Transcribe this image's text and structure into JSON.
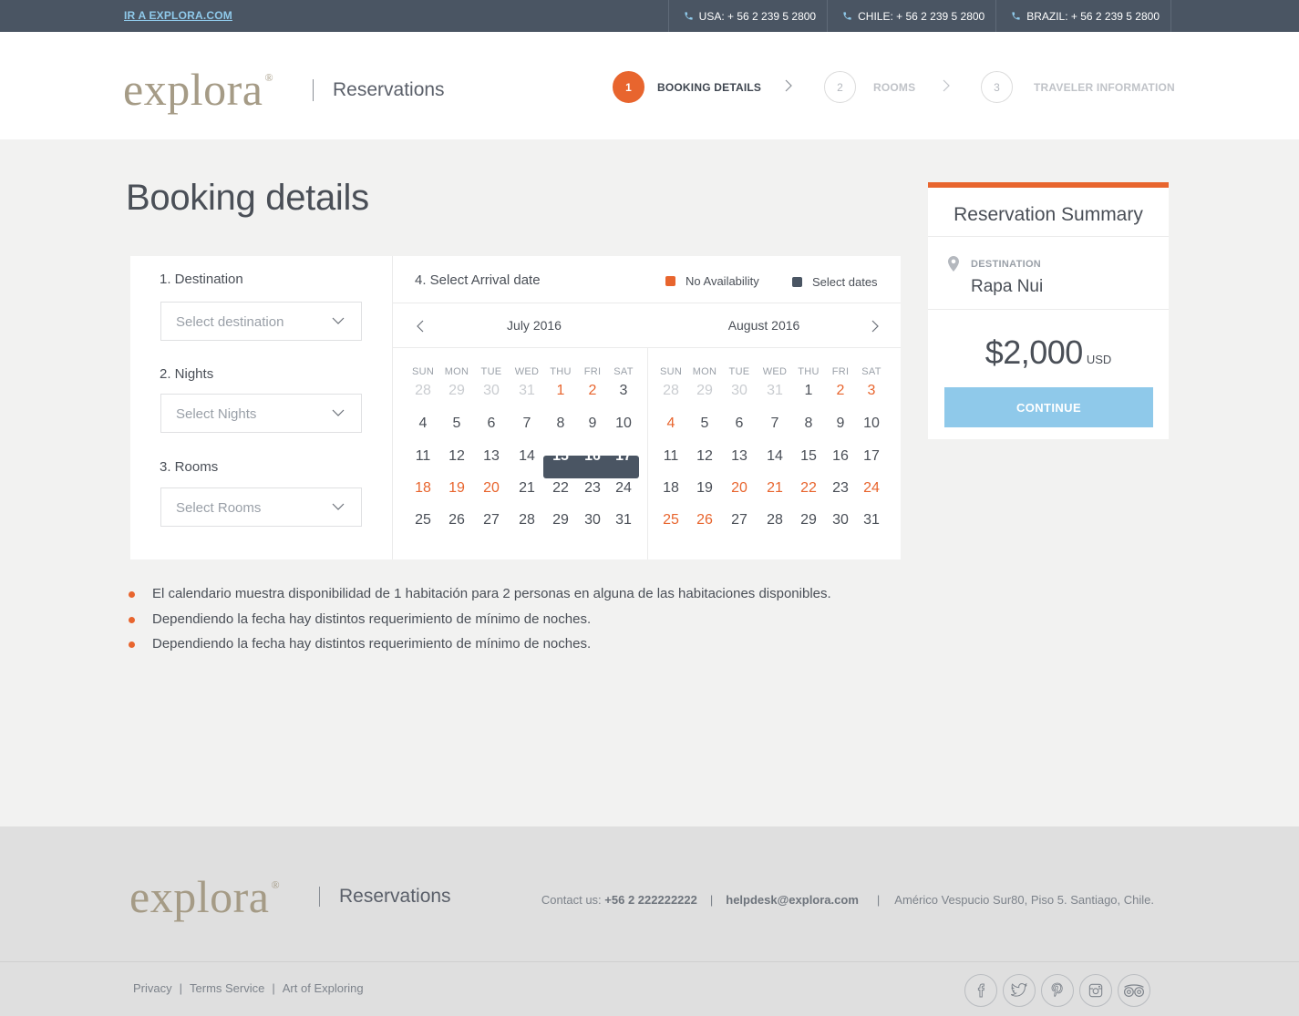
{
  "topbar": {
    "home_link": "IR A EXPLORA.COM",
    "phones": [
      {
        "label": "USA: + 56 2 239 5 2800"
      },
      {
        "label": "CHILE: + 56 2 239 5 2800"
      },
      {
        "label": "BRAZIL: + 56 2 239 5 2800"
      }
    ]
  },
  "header": {
    "logo": "explora",
    "logo_mark": "®",
    "app_name": "Reservations",
    "steps": [
      {
        "number": "1",
        "label": "BOOKING DETAILS",
        "active": true
      },
      {
        "number": "2",
        "label": "ROOMS",
        "active": false
      },
      {
        "number": "3",
        "label": "TRAVELER INFORMATION",
        "active": false
      }
    ]
  },
  "page_title": "Booking details",
  "form": {
    "destination": {
      "label": "1. Destination",
      "placeholder": "Select destination"
    },
    "nights": {
      "label": "2. Nights",
      "placeholder": "Select Nights"
    },
    "rooms": {
      "label": "3. Rooms",
      "placeholder": "Select Rooms"
    }
  },
  "calendar": {
    "title": "4. Select Arrival date",
    "legend": {
      "no_availability": "No Availability",
      "select_dates": "Select dates"
    },
    "weekdays": [
      "SUN",
      "MON",
      "TUE",
      "WED",
      "THU",
      "FRI",
      "SAT"
    ],
    "months": [
      {
        "name": "July 2016",
        "weeks": [
          [
            {
              "d": "28",
              "s": "muted"
            },
            {
              "d": "29",
              "s": "muted"
            },
            {
              "d": "30",
              "s": "muted"
            },
            {
              "d": "31",
              "s": "muted"
            },
            {
              "d": "1",
              "s": "unavail"
            },
            {
              "d": "2",
              "s": "unavail"
            },
            {
              "d": "3",
              "s": ""
            }
          ],
          [
            {
              "d": "4",
              "s": ""
            },
            {
              "d": "5",
              "s": ""
            },
            {
              "d": "6",
              "s": ""
            },
            {
              "d": "7",
              "s": ""
            },
            {
              "d": "8",
              "s": ""
            },
            {
              "d": "9",
              "s": ""
            },
            {
              "d": "10",
              "s": ""
            }
          ],
          [
            {
              "d": "11",
              "s": ""
            },
            {
              "d": "12",
              "s": ""
            },
            {
              "d": "13",
              "s": ""
            },
            {
              "d": "14",
              "s": ""
            },
            {
              "d": "15",
              "s": "sel"
            },
            {
              "d": "16",
              "s": "sel"
            },
            {
              "d": "17",
              "s": "sel"
            }
          ],
          [
            {
              "d": "18",
              "s": "unavail"
            },
            {
              "d": "19",
              "s": "unavail"
            },
            {
              "d": "20",
              "s": "unavail"
            },
            {
              "d": "21",
              "s": ""
            },
            {
              "d": "22",
              "s": ""
            },
            {
              "d": "23",
              "s": ""
            },
            {
              "d": "24",
              "s": ""
            }
          ],
          [
            {
              "d": "25",
              "s": ""
            },
            {
              "d": "26",
              "s": ""
            },
            {
              "d": "27",
              "s": ""
            },
            {
              "d": "28",
              "s": ""
            },
            {
              "d": "29",
              "s": ""
            },
            {
              "d": "30",
              "s": ""
            },
            {
              "d": "31",
              "s": ""
            }
          ]
        ]
      },
      {
        "name": "August 2016",
        "weeks": [
          [
            {
              "d": "28",
              "s": "muted"
            },
            {
              "d": "29",
              "s": "muted"
            },
            {
              "d": "30",
              "s": "muted"
            },
            {
              "d": "31",
              "s": "muted"
            },
            {
              "d": "1",
              "s": ""
            },
            {
              "d": "2",
              "s": "unavail"
            },
            {
              "d": "3",
              "s": "unavail"
            }
          ],
          [
            {
              "d": "4",
              "s": "unavail"
            },
            {
              "d": "5",
              "s": ""
            },
            {
              "d": "6",
              "s": ""
            },
            {
              "d": "7",
              "s": ""
            },
            {
              "d": "8",
              "s": ""
            },
            {
              "d": "9",
              "s": ""
            },
            {
              "d": "10",
              "s": ""
            }
          ],
          [
            {
              "d": "11",
              "s": ""
            },
            {
              "d": "12",
              "s": ""
            },
            {
              "d": "13",
              "s": ""
            },
            {
              "d": "14",
              "s": ""
            },
            {
              "d": "15",
              "s": ""
            },
            {
              "d": "16",
              "s": ""
            },
            {
              "d": "17",
              "s": ""
            }
          ],
          [
            {
              "d": "18",
              "s": ""
            },
            {
              "d": "19",
              "s": ""
            },
            {
              "d": "20",
              "s": "unavail"
            },
            {
              "d": "21",
              "s": "unavail"
            },
            {
              "d": "22",
              "s": "unavail"
            },
            {
              "d": "23",
              "s": ""
            },
            {
              "d": "24",
              "s": "unavail"
            }
          ],
          [
            {
              "d": "25",
              "s": "unavail"
            },
            {
              "d": "26",
              "s": "unavail"
            },
            {
              "d": "27",
              "s": ""
            },
            {
              "d": "28",
              "s": ""
            },
            {
              "d": "29",
              "s": ""
            },
            {
              "d": "30",
              "s": ""
            },
            {
              "d": "31",
              "s": ""
            }
          ]
        ]
      }
    ]
  },
  "notes": [
    "El calendario muestra disponibilidad de 1 habitación para 2 personas en alguna de las habitaciones disponibles.",
    "Dependiendo la fecha hay distintos requerimiento de mínimo de noches.",
    "Dependiendo la fecha hay distintos requerimiento de mínimo de noches."
  ],
  "summary": {
    "title": "Reservation Summary",
    "destination_label": "DESTINATION",
    "destination_value": "Rapa Nui",
    "price": "$2,000",
    "currency": "USD",
    "continue_label": "CONTINUE"
  },
  "footer": {
    "logo": "explora",
    "logo_mark": "®",
    "app_name": "Reservations",
    "contact_prefix": "Contact us:",
    "phone": "+56 2 222222222",
    "email": "helpdesk@explora.com",
    "address": "Américo Vespucio Sur80, Piso 5. Santiago, Chile.",
    "links": [
      "Privacy",
      "Terms Service",
      "Art of Exploring"
    ],
    "social_icons": [
      "facebook-icon",
      "twitter-icon",
      "pinterest-icon",
      "instagram-icon",
      "tripadvisor-icon"
    ]
  },
  "colors": {
    "accent": "#e8652e",
    "selected": "#4a5563",
    "button": "#8fc9ea",
    "topbar": "#4a5563"
  }
}
